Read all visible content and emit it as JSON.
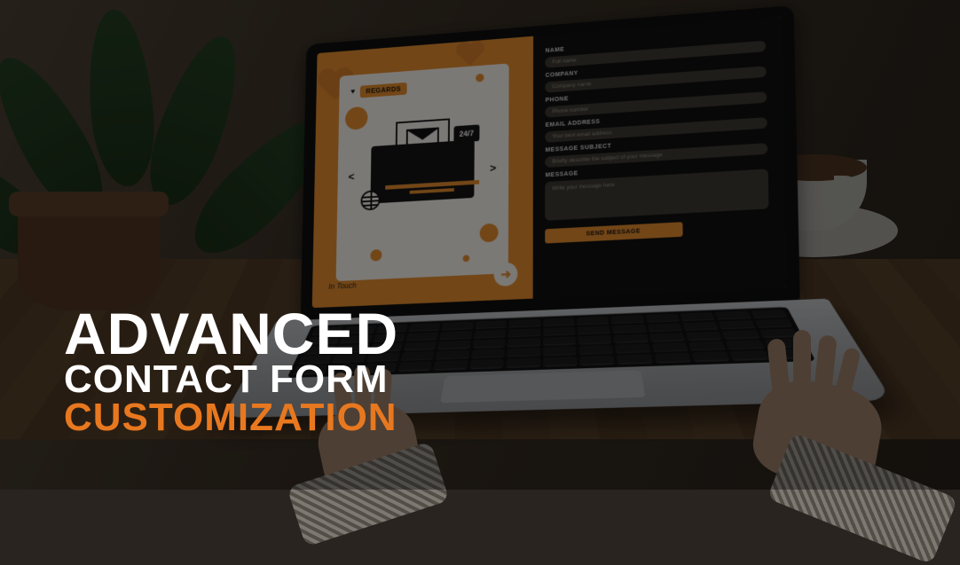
{
  "headline": {
    "line1": "ADVANCED",
    "line2": "CONTACT FORM",
    "line3": "CUSTOMIZATION"
  },
  "screen": {
    "regards_label": "REGARDS",
    "badge": "24/7",
    "in_touch": "In Touch",
    "arrow_glyph": "➜"
  },
  "form": {
    "name": {
      "label": "NAME",
      "placeholder": "Full name"
    },
    "company": {
      "label": "COMPANY",
      "placeholder": "Company name"
    },
    "phone": {
      "label": "PHONE",
      "placeholder": "Phone number"
    },
    "email": {
      "label": "EMAIL ADDRESS",
      "placeholder": "Your best email address"
    },
    "subject": {
      "label": "MESSAGE SUBJECT",
      "placeholder": "Briefly describe the subject of your message"
    },
    "message": {
      "label": "MESSAGE",
      "placeholder": "Write your message here"
    },
    "submit": "SEND MESSAGE"
  }
}
